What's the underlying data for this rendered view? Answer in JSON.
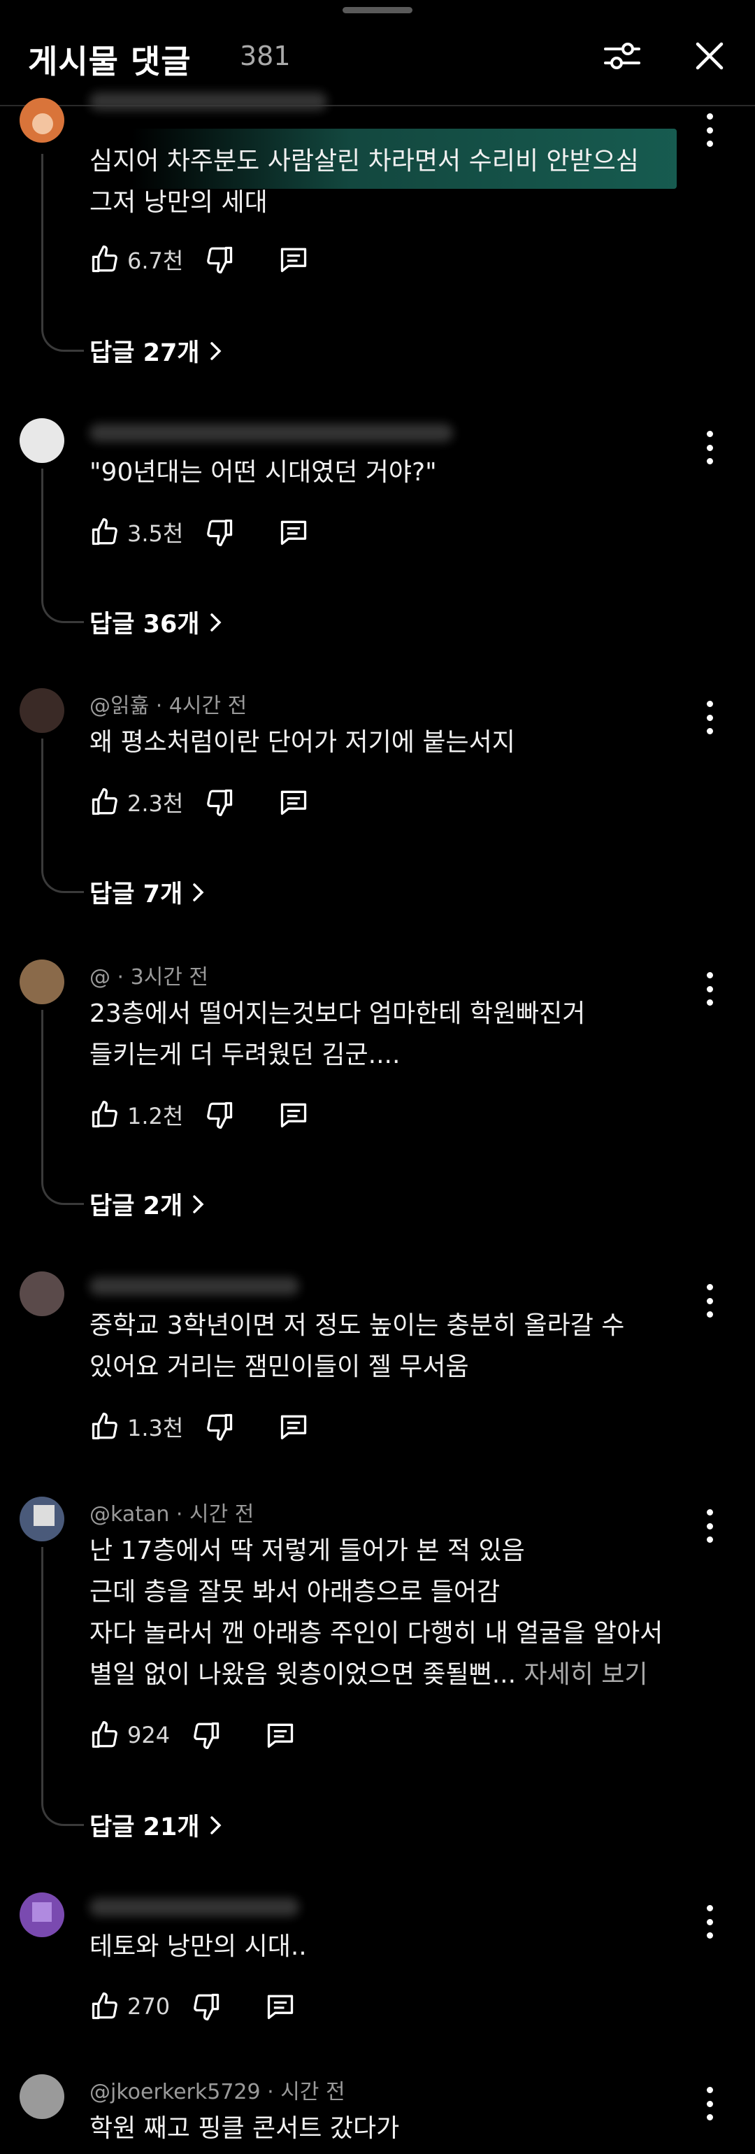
{
  "header": {
    "title": "게시물 댓글",
    "count": "381",
    "filter_icon": "sliders-icon",
    "close_icon": "close-icon"
  },
  "comments": [
    {
      "meta": "@위황  · 시간 전",
      "text": [
        "심지어 차주분도 사람살린 차라면서 수리비 안받으심",
        "그저 낭만의 세대"
      ],
      "likes": "6.7천",
      "replies": "답글 27개",
      "avatar_color": "#d9743a"
    },
    {
      "meta": "@ · 시간 전",
      "text": [
        "\"90년대는 어떤 시대였던 거야?\""
      ],
      "likes": "3.5천",
      "replies": "답글 36개",
      "avatar_color": "#e8e8e8"
    },
    {
      "meta": "@읽휾 · 4시간 전",
      "text": [
        "왜 평소처럼이란 단어가 저기에 붙는서지"
      ],
      "likes": "2.3천",
      "replies": "답글 7개",
      "avatar_color": "#3a2a26"
    },
    {
      "meta": "@ · 3시간 전",
      "text": [
        "23층에서 떨어지는것보다 엄마한테 학원빠진거",
        "들키는게 더 두려웠던 김군...."
      ],
      "likes": "1.2천",
      "replies": "답글 2개",
      "avatar_color": "#8a6a4a"
    },
    {
      "meta": "@ · 시간 전",
      "text": [
        "중학교 3학년이면 저 정도 높이는 충분히 올라갈 수",
        "있어요 거리는 잼민이들이 젤 무서움"
      ],
      "likes": "1.3천",
      "replies": "",
      "avatar_color": "#5a4a4a"
    },
    {
      "meta": "@katan · 시간 전",
      "text": [
        "난 17층에서 딱 저렇게 들어가 본 적 있음",
        "근데 층을 잘못 봐서 아래층으로 들어감",
        "자다 놀라서 깬 아래층 주인이 다행히 내 얼굴을 알아서",
        "별일 없이 나왔음 윗층이었으면 좆될뻔..."
      ],
      "more": " 자세히 보기",
      "likes": "924",
      "replies": "답글 21개",
      "avatar_color": "#4a5a7a"
    },
    {
      "meta": "@ · 시간 전",
      "text": [
        "테토와 낭만의 시대.."
      ],
      "likes": "270",
      "replies": "",
      "avatar_color": "#7a4ab0"
    },
    {
      "meta": "@jkoerkerk5729 · 시간 전",
      "text": [
        "학원 째고 핑클 콘서트 갔다가"
      ],
      "likes": "",
      "replies": "",
      "avatar_color": "#9a9a9a"
    }
  ]
}
